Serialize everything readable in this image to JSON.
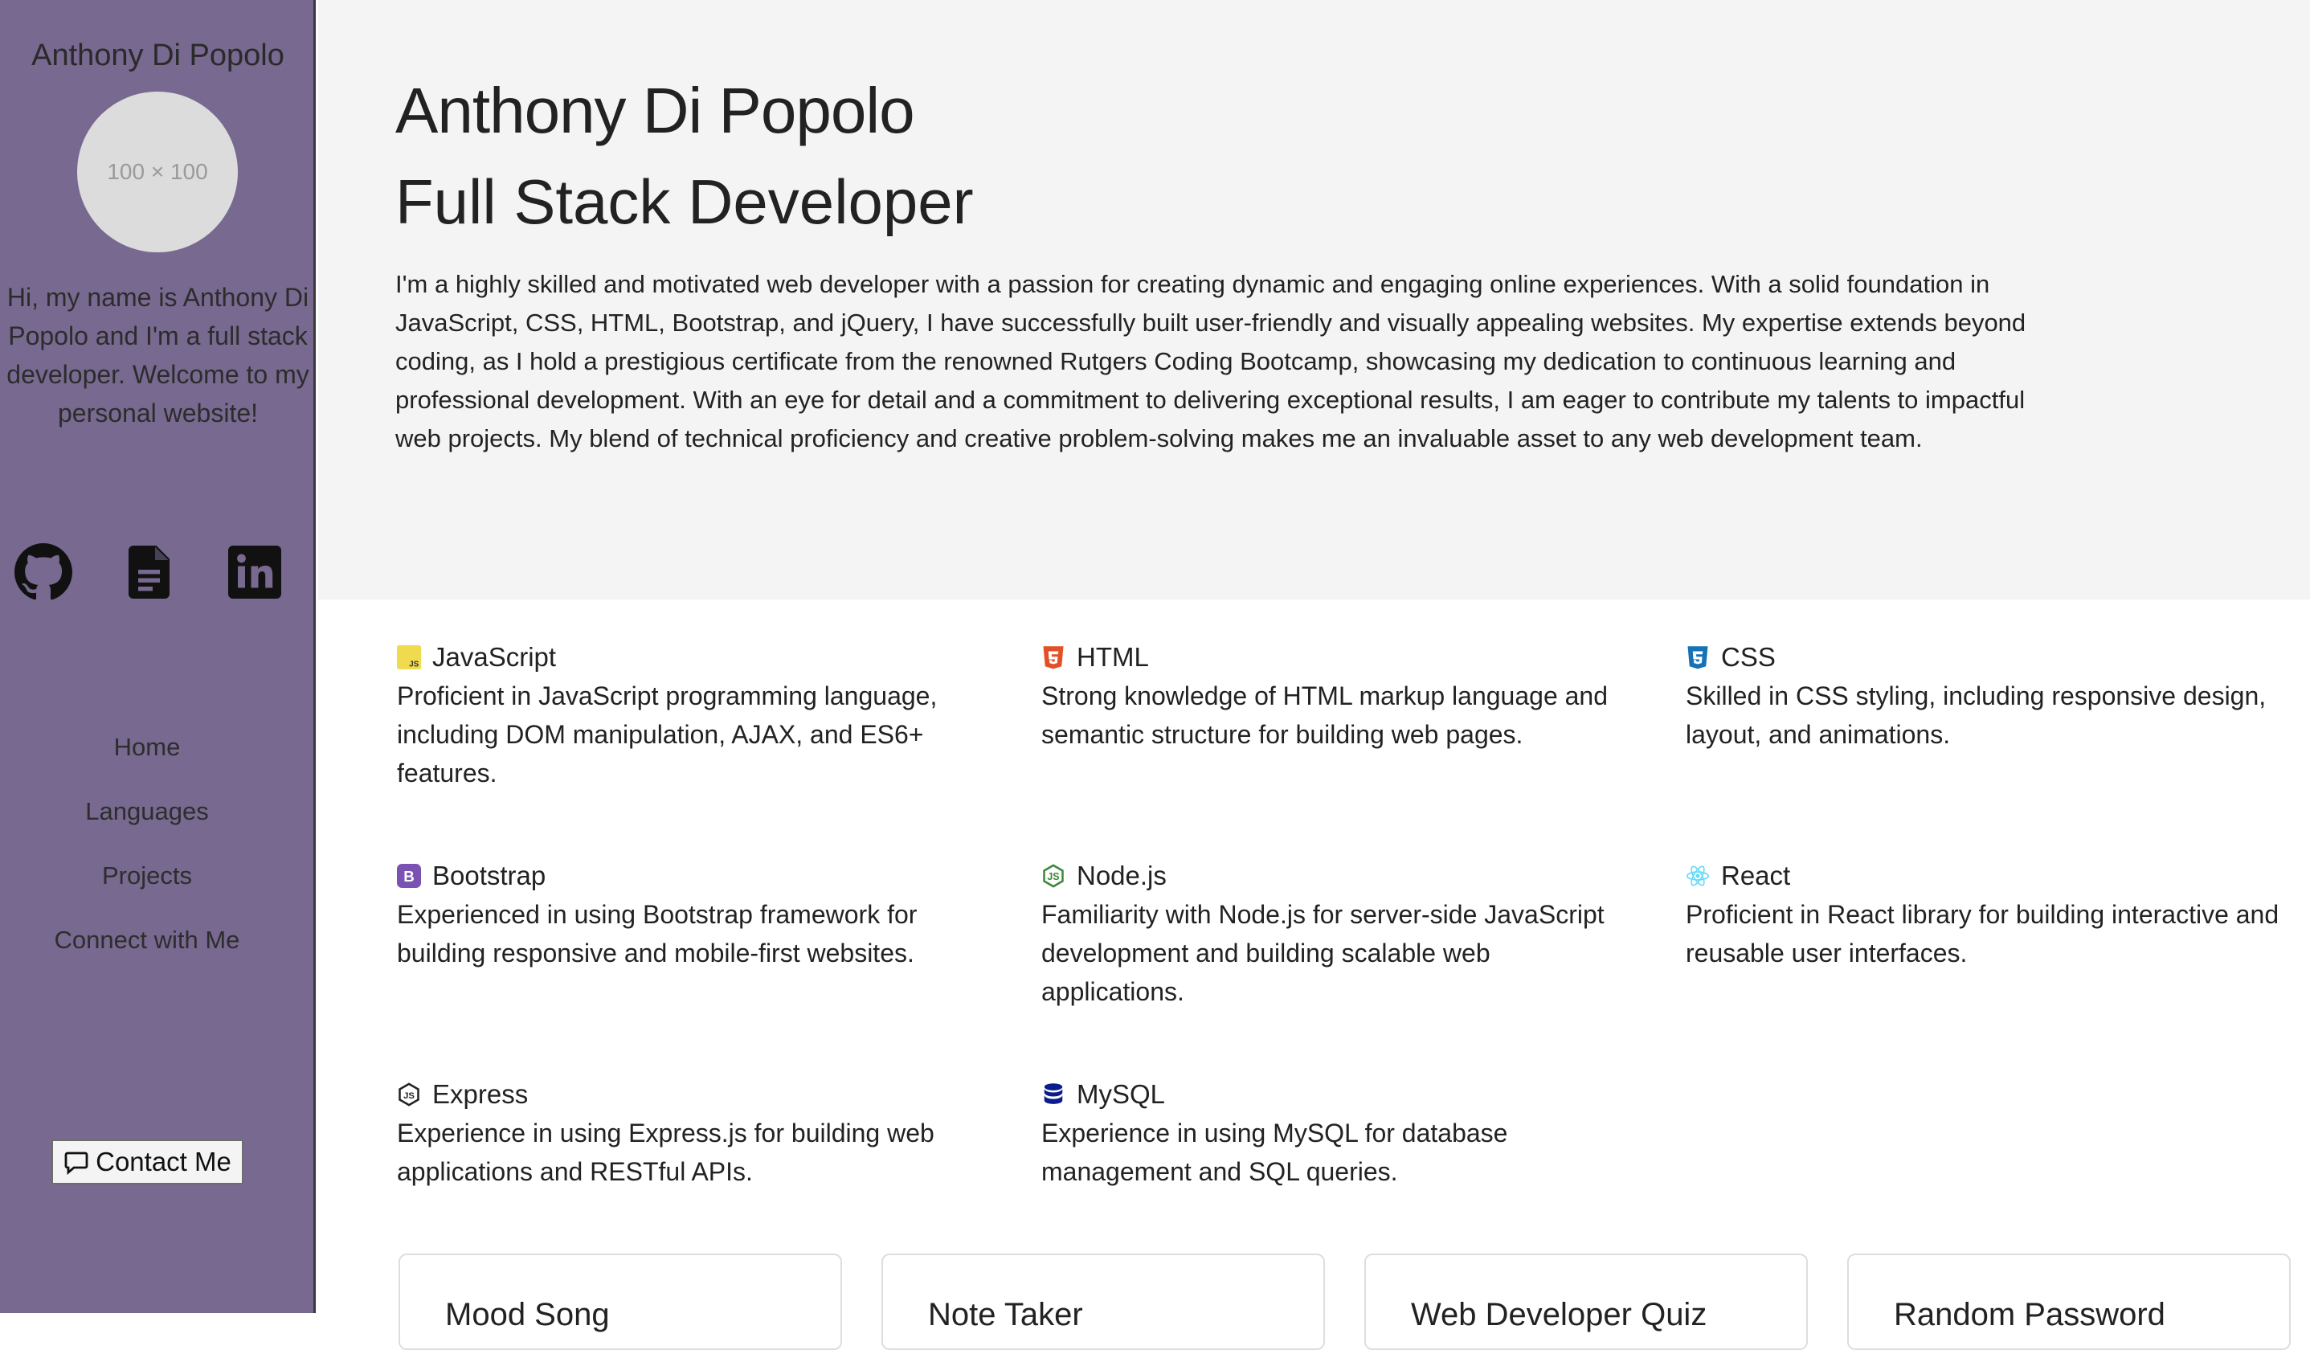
{
  "sidebar": {
    "name": "Anthony Di Popolo",
    "avatar_placeholder": "100 × 100",
    "bio": "Hi, my name is Anthony Di Popolo and I'm a full stack developer. Welcome to my personal website!",
    "social": [
      {
        "icon": "github-icon"
      },
      {
        "icon": "file-text-icon"
      },
      {
        "icon": "linkedin-icon"
      }
    ],
    "nav": [
      {
        "label": "Home"
      },
      {
        "label": "Languages"
      },
      {
        "label": "Projects"
      },
      {
        "label": "Connect with Me"
      }
    ],
    "contact_label": "Contact Me",
    "contact_icon": "chat-icon"
  },
  "hero": {
    "name": "Anthony Di Popolo",
    "role": "Full Stack Developer",
    "about": "I'm a highly skilled and motivated web developer with a passion for creating dynamic and engaging online experiences. With a solid foundation in JavaScript, CSS, HTML, Bootstrap, and jQuery, I have successfully built user-friendly and visually appealing websites. My expertise extends beyond coding, as I hold a prestigious certificate from the renowned Rutgers Coding Bootcamp, showcasing my dedication to continuous learning and professional development. With an eye for detail and a commitment to delivering exceptional results, I am eager to contribute my talents to impactful web projects. My blend of technical proficiency and creative problem-solving makes me an invaluable asset to any web development team."
  },
  "skills": [
    {
      "name": "JavaScript",
      "icon": "javascript-icon",
      "desc": "Proficient in JavaScript programming language, including DOM manipulation, AJAX, and ES6+ features."
    },
    {
      "name": "HTML",
      "icon": "html5-icon",
      "desc": "Strong knowledge of HTML markup language and semantic structure for building web pages."
    },
    {
      "name": "CSS",
      "icon": "css3-icon",
      "desc": "Skilled in CSS styling, including responsive design, layout, and animations."
    },
    {
      "name": "Bootstrap",
      "icon": "bootstrap-icon",
      "desc": "Experienced in using Bootstrap framework for building responsive and mobile-first websites."
    },
    {
      "name": "Node.js",
      "icon": "nodejs-icon",
      "desc": "Familiarity with Node.js for server-side JavaScript development and building scalable web applications."
    },
    {
      "name": "React",
      "icon": "react-icon",
      "desc": "Proficient in React library for building interactive and reusable user interfaces."
    },
    {
      "name": "Express",
      "icon": "express-icon",
      "desc": "Experience in using Express.js for building web applications and RESTful APIs."
    },
    {
      "name": "MySQL",
      "icon": "database-icon",
      "desc": "Experience in using MySQL for database management and SQL queries."
    }
  ],
  "projects": [
    {
      "title": "Mood Song"
    },
    {
      "title": "Note Taker"
    },
    {
      "title": "Web Developer Quiz"
    },
    {
      "title": "Random Password"
    }
  ]
}
